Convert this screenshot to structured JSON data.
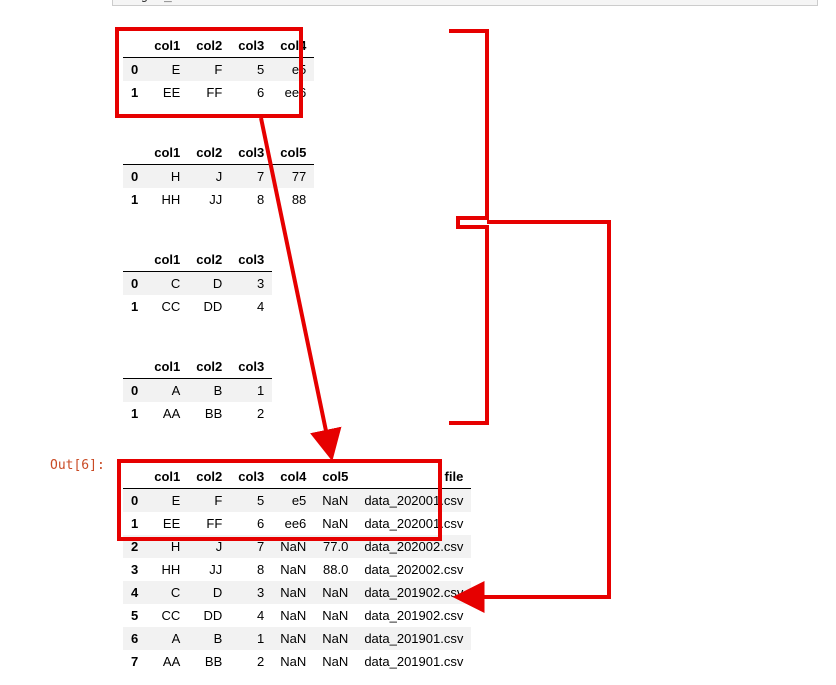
{
  "input_fragment": "merged_df",
  "out_label": "Out[6]:",
  "tables": [
    {
      "columns": [
        "col1",
        "col2",
        "col3",
        "col4"
      ],
      "rows": [
        {
          "idx": "0",
          "cells": [
            "E",
            "F",
            "5",
            "e5"
          ]
        },
        {
          "idx": "1",
          "cells": [
            "EE",
            "FF",
            "6",
            "ee6"
          ]
        }
      ]
    },
    {
      "columns": [
        "col1",
        "col2",
        "col3",
        "col5"
      ],
      "rows": [
        {
          "idx": "0",
          "cells": [
            "H",
            "J",
            "7",
            "77"
          ]
        },
        {
          "idx": "1",
          "cells": [
            "HH",
            "JJ",
            "8",
            "88"
          ]
        }
      ]
    },
    {
      "columns": [
        "col1",
        "col2",
        "col3"
      ],
      "rows": [
        {
          "idx": "0",
          "cells": [
            "C",
            "D",
            "3"
          ]
        },
        {
          "idx": "1",
          "cells": [
            "CC",
            "DD",
            "4"
          ]
        }
      ]
    },
    {
      "columns": [
        "col1",
        "col2",
        "col3"
      ],
      "rows": [
        {
          "idx": "0",
          "cells": [
            "A",
            "B",
            "1"
          ]
        },
        {
          "idx": "1",
          "cells": [
            "AA",
            "BB",
            "2"
          ]
        }
      ]
    }
  ],
  "merged": {
    "columns": [
      "col1",
      "col2",
      "col3",
      "col4",
      "col5",
      "file"
    ],
    "rows": [
      {
        "idx": "0",
        "cells": [
          "E",
          "F",
          "5",
          "e5",
          "NaN",
          "data_202001.csv"
        ]
      },
      {
        "idx": "1",
        "cells": [
          "EE",
          "FF",
          "6",
          "ee6",
          "NaN",
          "data_202001.csv"
        ]
      },
      {
        "idx": "2",
        "cells": [
          "H",
          "J",
          "7",
          "NaN",
          "77.0",
          "data_202002.csv"
        ]
      },
      {
        "idx": "3",
        "cells": [
          "HH",
          "JJ",
          "8",
          "NaN",
          "88.0",
          "data_202002.csv"
        ]
      },
      {
        "idx": "4",
        "cells": [
          "C",
          "D",
          "3",
          "NaN",
          "NaN",
          "data_201902.csv"
        ]
      },
      {
        "idx": "5",
        "cells": [
          "CC",
          "DD",
          "4",
          "NaN",
          "NaN",
          "data_201902.csv"
        ]
      },
      {
        "idx": "6",
        "cells": [
          "A",
          "B",
          "1",
          "NaN",
          "NaN",
          "data_201901.csv"
        ]
      },
      {
        "idx": "7",
        "cells": [
          "AA",
          "BB",
          "2",
          "NaN",
          "NaN",
          "data_201901.csv"
        ]
      }
    ]
  }
}
